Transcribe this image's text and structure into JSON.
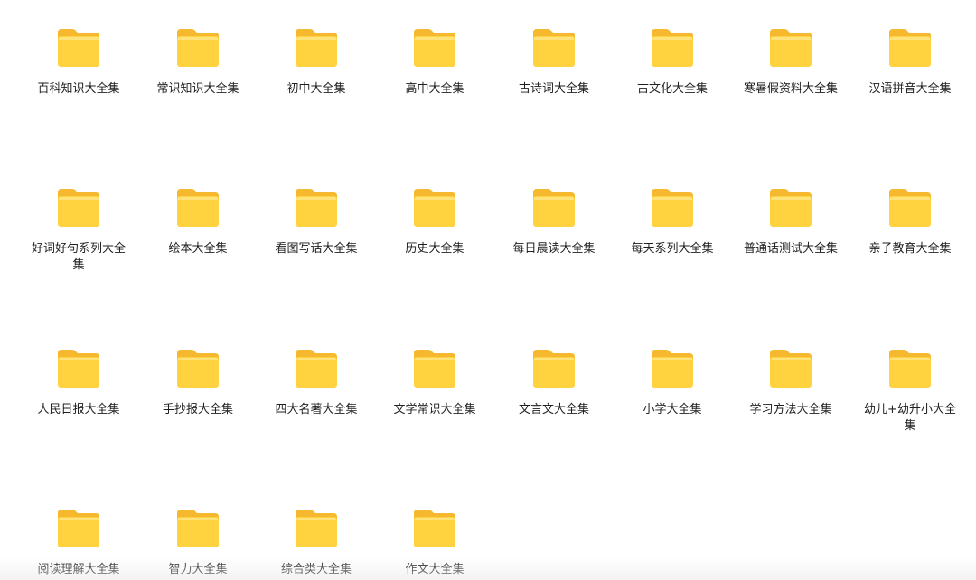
{
  "folders": [
    {
      "label": "百科知识大全集"
    },
    {
      "label": "常识知识大全集"
    },
    {
      "label": "初中大全集"
    },
    {
      "label": "高中大全集"
    },
    {
      "label": "古诗词大全集"
    },
    {
      "label": "古文化大全集"
    },
    {
      "label": "寒暑假资料大全集"
    },
    {
      "label": "汉语拼音大全集"
    },
    {
      "label": "好词好句系列大全集"
    },
    {
      "label": "绘本大全集"
    },
    {
      "label": "看图写话大全集"
    },
    {
      "label": "历史大全集"
    },
    {
      "label": "每日晨读大全集"
    },
    {
      "label": "每天系列大全集"
    },
    {
      "label": "普通话测试大全集"
    },
    {
      "label": "亲子教育大全集"
    },
    {
      "label": "人民日报大全集"
    },
    {
      "label": "手抄报大全集"
    },
    {
      "label": "四大名著大全集"
    },
    {
      "label": "文学常识大全集"
    },
    {
      "label": "文言文大全集"
    },
    {
      "label": "小学大全集"
    },
    {
      "label": "学习方法大全集"
    },
    {
      "label": "幼儿+幼升小大全集"
    },
    {
      "label": "阅读理解大全集"
    },
    {
      "label": "智力大全集"
    },
    {
      "label": "综合类大全集"
    },
    {
      "label": "作文大全集"
    }
  ],
  "icon": "folder-icon",
  "colors": {
    "folder_front": "#FFD23F",
    "folder_back": "#F5B82E",
    "folder_highlight": "#FFE27A"
  }
}
